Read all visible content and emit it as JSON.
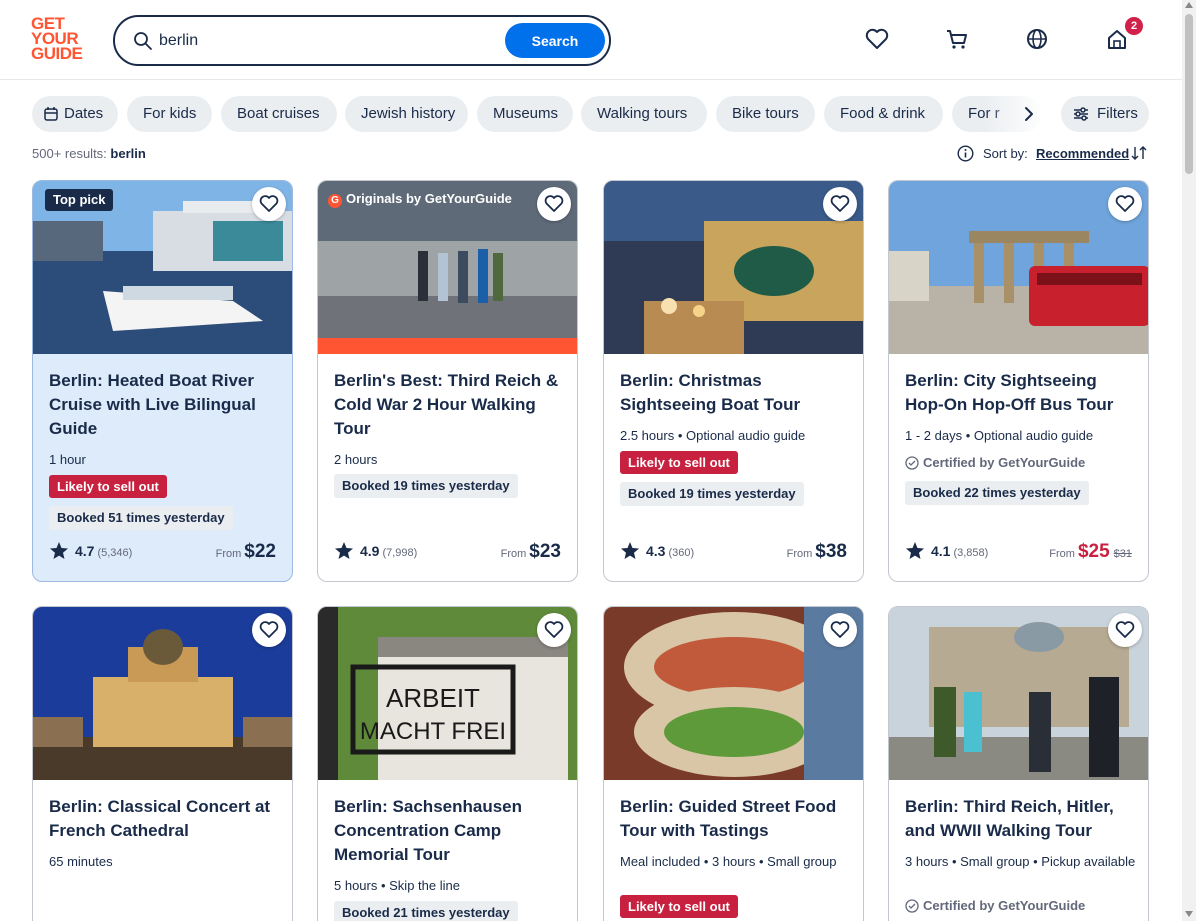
{
  "logo": {
    "line1": "GET",
    "line2": "YOUR",
    "line3": "GUIDE"
  },
  "search": {
    "value": "berlin",
    "button_label": "Search"
  },
  "header": {
    "cart_badge": "2"
  },
  "chips": [
    {
      "label": "Dates",
      "icon": "calendar-icon"
    },
    {
      "label": "For kids"
    },
    {
      "label": "Boat cruises"
    },
    {
      "label": "Jewish history"
    },
    {
      "label": "Museums"
    },
    {
      "label": "Walking tours"
    },
    {
      "label": "Bike tours"
    },
    {
      "label": "Food & drink"
    },
    {
      "label": "For r"
    }
  ],
  "filters_label": "Filters",
  "results": {
    "prefix": "500+ results:",
    "query": "berlin"
  },
  "sort": {
    "label": "Sort by:",
    "value": "Recommended"
  },
  "cards": [
    {
      "tag": "Top pick",
      "title": "Berlin: Heated Boat River Cruise with Live Bilingual Guide",
      "meta": "1 hour",
      "sell_out": "Likely to sell out",
      "booked": "Booked 51 times yesterday",
      "rating": "4.7",
      "reviews": "(5,346)",
      "from": "From",
      "price": "$22"
    },
    {
      "tag": "Originals by GetYourGuide",
      "title": "Berlin's Best: Third Reich & Cold War 2 Hour Walking Tour",
      "meta": "2 hours",
      "booked": "Booked 19 times yesterday",
      "rating": "4.9",
      "reviews": "(7,998)",
      "from": "From",
      "price": "$23"
    },
    {
      "title": "Berlin: Christmas Sightseeing Boat Tour",
      "meta": "2.5 hours • Optional audio guide",
      "sell_out": "Likely to sell out",
      "booked": "Booked 19 times yesterday",
      "rating": "4.3",
      "reviews": "(360)",
      "from": "From",
      "price": "$38"
    },
    {
      "title": "Berlin: City Sightseeing Hop-On Hop-Off Bus Tour",
      "meta": "1 - 2 days • Optional audio guide",
      "certified": "Certified by GetYourGuide",
      "booked": "Booked 22 times yesterday",
      "rating": "4.1",
      "reviews": "(3,858)",
      "from": "From",
      "price": "$25",
      "old_price": "$31"
    },
    {
      "title": "Berlin: Classical Concert at French Cathedral",
      "meta": "65 minutes"
    },
    {
      "title": "Berlin: Sachsenhausen Concentration Camp Memorial Tour",
      "meta": "5 hours • Skip the line",
      "booked": "Booked 21 times yesterday",
      "image_text_1": "ARBEIT",
      "image_text_2": "MACHT FREI"
    },
    {
      "title": "Berlin: Guided Street Food Tour with Tastings",
      "meta": "Meal included • 3 hours • Small group",
      "sell_out": "Likely to sell out"
    },
    {
      "title": "Berlin: Third Reich, Hitler, and WWII Walking Tour",
      "meta": "3 hours • Small group • Pickup available",
      "certified": "Certified by GetYourGuide"
    }
  ],
  "colors": {
    "brand": "#ff5533",
    "primary": "#0071eb",
    "sell_out": "#c8203f",
    "navy": "#1a2b49"
  }
}
